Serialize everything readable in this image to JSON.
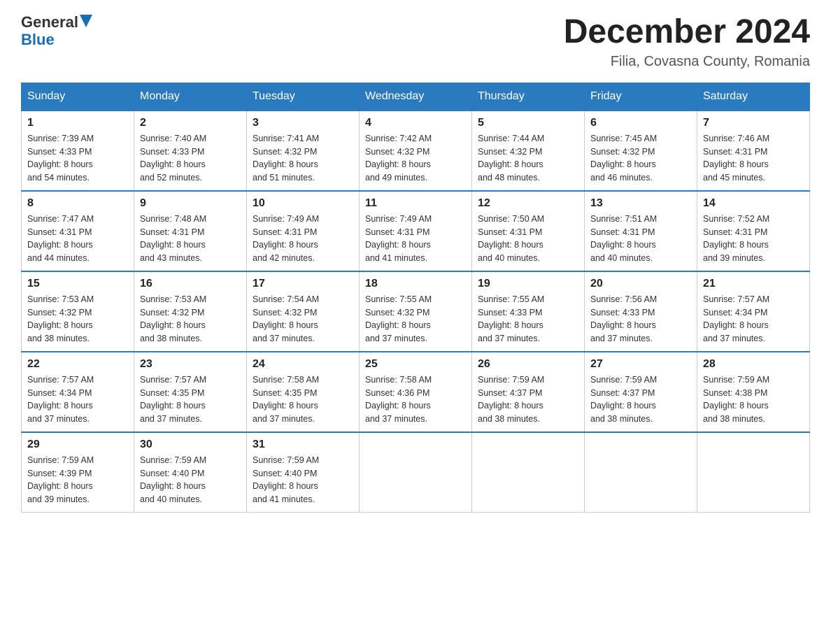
{
  "header": {
    "logo_general": "General",
    "logo_blue": "Blue",
    "month_title": "December 2024",
    "location": "Filia, Covasna County, Romania"
  },
  "days_of_week": [
    "Sunday",
    "Monday",
    "Tuesday",
    "Wednesday",
    "Thursday",
    "Friday",
    "Saturday"
  ],
  "weeks": [
    [
      {
        "day": "1",
        "sunrise": "7:39 AM",
        "sunset": "4:33 PM",
        "daylight": "8 hours and 54 minutes."
      },
      {
        "day": "2",
        "sunrise": "7:40 AM",
        "sunset": "4:33 PM",
        "daylight": "8 hours and 52 minutes."
      },
      {
        "day": "3",
        "sunrise": "7:41 AM",
        "sunset": "4:32 PM",
        "daylight": "8 hours and 51 minutes."
      },
      {
        "day": "4",
        "sunrise": "7:42 AM",
        "sunset": "4:32 PM",
        "daylight": "8 hours and 49 minutes."
      },
      {
        "day": "5",
        "sunrise": "7:44 AM",
        "sunset": "4:32 PM",
        "daylight": "8 hours and 48 minutes."
      },
      {
        "day": "6",
        "sunrise": "7:45 AM",
        "sunset": "4:32 PM",
        "daylight": "8 hours and 46 minutes."
      },
      {
        "day": "7",
        "sunrise": "7:46 AM",
        "sunset": "4:31 PM",
        "daylight": "8 hours and 45 minutes."
      }
    ],
    [
      {
        "day": "8",
        "sunrise": "7:47 AM",
        "sunset": "4:31 PM",
        "daylight": "8 hours and 44 minutes."
      },
      {
        "day": "9",
        "sunrise": "7:48 AM",
        "sunset": "4:31 PM",
        "daylight": "8 hours and 43 minutes."
      },
      {
        "day": "10",
        "sunrise": "7:49 AM",
        "sunset": "4:31 PM",
        "daylight": "8 hours and 42 minutes."
      },
      {
        "day": "11",
        "sunrise": "7:49 AM",
        "sunset": "4:31 PM",
        "daylight": "8 hours and 41 minutes."
      },
      {
        "day": "12",
        "sunrise": "7:50 AM",
        "sunset": "4:31 PM",
        "daylight": "8 hours and 40 minutes."
      },
      {
        "day": "13",
        "sunrise": "7:51 AM",
        "sunset": "4:31 PM",
        "daylight": "8 hours and 40 minutes."
      },
      {
        "day": "14",
        "sunrise": "7:52 AM",
        "sunset": "4:31 PM",
        "daylight": "8 hours and 39 minutes."
      }
    ],
    [
      {
        "day": "15",
        "sunrise": "7:53 AM",
        "sunset": "4:32 PM",
        "daylight": "8 hours and 38 minutes."
      },
      {
        "day": "16",
        "sunrise": "7:53 AM",
        "sunset": "4:32 PM",
        "daylight": "8 hours and 38 minutes."
      },
      {
        "day": "17",
        "sunrise": "7:54 AM",
        "sunset": "4:32 PM",
        "daylight": "8 hours and 37 minutes."
      },
      {
        "day": "18",
        "sunrise": "7:55 AM",
        "sunset": "4:32 PM",
        "daylight": "8 hours and 37 minutes."
      },
      {
        "day": "19",
        "sunrise": "7:55 AM",
        "sunset": "4:33 PM",
        "daylight": "8 hours and 37 minutes."
      },
      {
        "day": "20",
        "sunrise": "7:56 AM",
        "sunset": "4:33 PM",
        "daylight": "8 hours and 37 minutes."
      },
      {
        "day": "21",
        "sunrise": "7:57 AM",
        "sunset": "4:34 PM",
        "daylight": "8 hours and 37 minutes."
      }
    ],
    [
      {
        "day": "22",
        "sunrise": "7:57 AM",
        "sunset": "4:34 PM",
        "daylight": "8 hours and 37 minutes."
      },
      {
        "day": "23",
        "sunrise": "7:57 AM",
        "sunset": "4:35 PM",
        "daylight": "8 hours and 37 minutes."
      },
      {
        "day": "24",
        "sunrise": "7:58 AM",
        "sunset": "4:35 PM",
        "daylight": "8 hours and 37 minutes."
      },
      {
        "day": "25",
        "sunrise": "7:58 AM",
        "sunset": "4:36 PM",
        "daylight": "8 hours and 37 minutes."
      },
      {
        "day": "26",
        "sunrise": "7:59 AM",
        "sunset": "4:37 PM",
        "daylight": "8 hours and 38 minutes."
      },
      {
        "day": "27",
        "sunrise": "7:59 AM",
        "sunset": "4:37 PM",
        "daylight": "8 hours and 38 minutes."
      },
      {
        "day": "28",
        "sunrise": "7:59 AM",
        "sunset": "4:38 PM",
        "daylight": "8 hours and 38 minutes."
      }
    ],
    [
      {
        "day": "29",
        "sunrise": "7:59 AM",
        "sunset": "4:39 PM",
        "daylight": "8 hours and 39 minutes."
      },
      {
        "day": "30",
        "sunrise": "7:59 AM",
        "sunset": "4:40 PM",
        "daylight": "8 hours and 40 minutes."
      },
      {
        "day": "31",
        "sunrise": "7:59 AM",
        "sunset": "4:40 PM",
        "daylight": "8 hours and 41 minutes."
      },
      null,
      null,
      null,
      null
    ]
  ],
  "labels": {
    "sunrise": "Sunrise:",
    "sunset": "Sunset:",
    "daylight": "Daylight:"
  }
}
